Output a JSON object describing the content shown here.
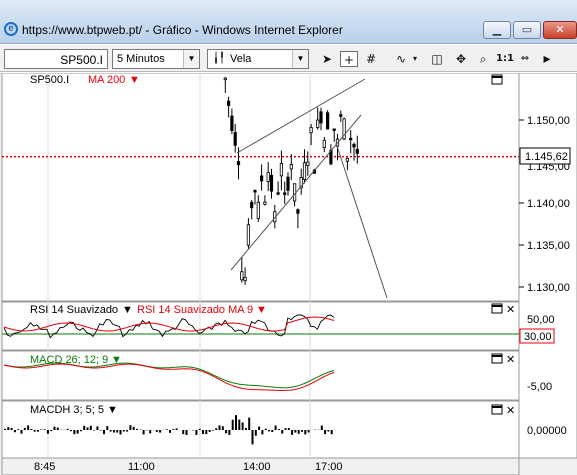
{
  "window": {
    "url": "https://www.btpweb.pt/",
    "separator": " - ",
    "page": "Gráfico",
    "app": "Windows Internet Explorer",
    "icon": "ie-icon",
    "minimize": "▁",
    "maximize": "▭",
    "close": "✕"
  },
  "toolbar": {
    "symbol": "SP500.I",
    "interval": "5 Minutos",
    "chart_type": "Vela",
    "tools": [
      "cursor-icon",
      "crosshair-icon",
      "grid-icon",
      "indicator-icon",
      "drawing-tools-icon",
      "zoom-icon",
      "ratio-icon",
      "more-icon"
    ],
    "ratio_label": "1:1"
  },
  "colors": {
    "frame_bg": "#f0f0f0",
    "red": "#e8000a",
    "green": "#0a7a0a",
    "grid": "#d8d8d8",
    "dotted_level": "#d40000"
  },
  "chart_data": [
    {
      "type": "candlestick",
      "panel": "price",
      "title": "SP500.I",
      "overlay": "MA 200",
      "y_ticks": [
        "1.150,00",
        "1.145,00",
        "1.140,00",
        "1.135,00",
        "1.130,00"
      ],
      "last_price_label": "1.145,62",
      "last_price": 1145.62,
      "ylim": [
        1128,
        1158
      ],
      "trendlines": "rising wedge (two converging up-sloping lines) with a projected downward line"
    },
    {
      "type": "line",
      "panel": "rsi",
      "series": [
        {
          "name": "RSI 14 Suavizado"
        },
        {
          "name": "RSI 14 Suavizado MA 9"
        }
      ],
      "y_ticks": [
        "50,00"
      ],
      "level_label": "30,00",
      "level": 30
    },
    {
      "type": "line",
      "panel": "macd",
      "series": [
        {
          "name": "MACD 26; 12; 9"
        }
      ],
      "y_ticks": [
        "-5,00"
      ]
    },
    {
      "type": "bar",
      "panel": "macdh",
      "series": [
        {
          "name": "MACDH 3; 5; 5"
        }
      ],
      "y_ticks": [
        "0,00000"
      ]
    }
  ],
  "x_axis": {
    "ticks": [
      "8:45",
      "11:00",
      "14:00",
      "17:00"
    ]
  }
}
